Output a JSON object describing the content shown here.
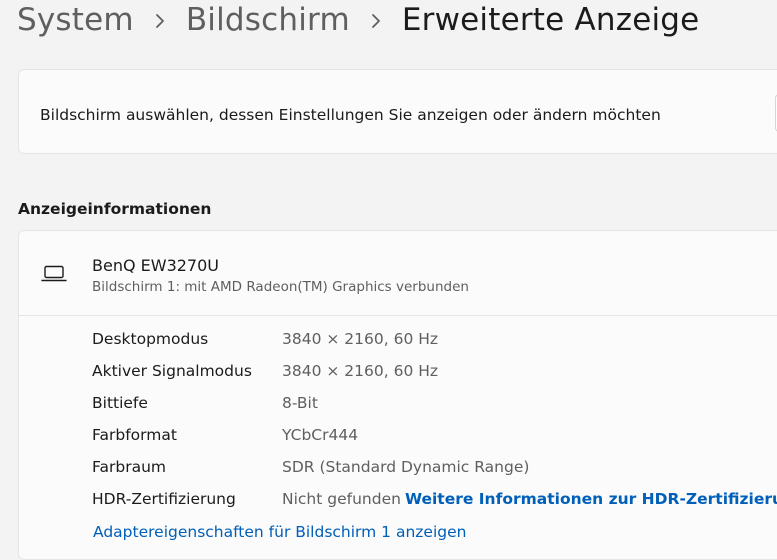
{
  "breadcrumb": {
    "items": [
      "System",
      "Bildschirm",
      "Erweiterte Anzeige"
    ]
  },
  "select_display": {
    "label": "Bildschirm auswählen, dessen Einstellungen Sie anzeigen oder ändern möchten"
  },
  "display_info": {
    "section_title": "Anzeigeinformationen",
    "monitor_name": "BenQ EW3270U",
    "monitor_subtitle": "Bildschirm 1: mit AMD Radeon(TM) Graphics verbunden",
    "rows": [
      {
        "label": "Desktopmodus",
        "value": "3840 × 2160, 60 Hz"
      },
      {
        "label": "Aktiver Signalmodus",
        "value": "3840 × 2160, 60 Hz"
      },
      {
        "label": "Bittiefe",
        "value": "8-Bit"
      },
      {
        "label": "Farbformat",
        "value": "YCbCr444"
      },
      {
        "label": "Farbraum",
        "value": "SDR (Standard Dynamic Range)"
      },
      {
        "label": "HDR-Zertifizierung",
        "value": "Nicht gefunden",
        "link": "Weitere Informationen zur HDR-Zertifizierung"
      }
    ],
    "adapter_link": "Adaptereigenschaften für Bildschirm 1 anzeigen"
  },
  "icons": {
    "separator": "chevron-right-icon",
    "monitor": "laptop-icon"
  },
  "colors": {
    "link": "#005fb8",
    "background": "#f3f3f3",
    "card": "#fbfbfb"
  }
}
